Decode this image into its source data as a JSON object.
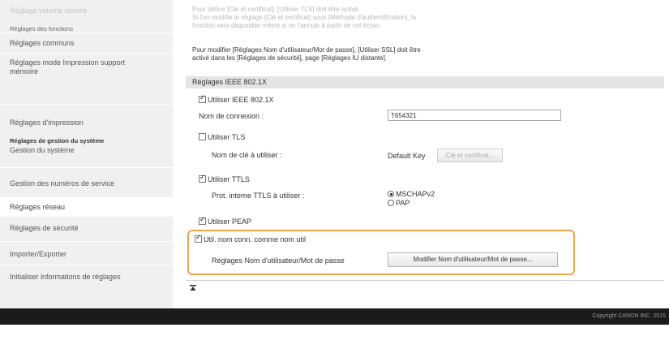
{
  "sidebar": {
    "cut_item": "Réglage volume sonore",
    "section_functions": "Réglages des fonctions",
    "items_functions": [
      "Réglages communs",
      "Réglages mode Impression support mémoire",
      "Réglages d'impression"
    ],
    "section_system": "Réglages de gestion du système",
    "items_system": [
      "Gestion du système",
      "Gestion des numéros de service",
      "Réglages réseau",
      "Réglages de sécurité",
      "Importer/Exporter",
      "Initialiser informations de réglages"
    ]
  },
  "notes": {
    "faded": [
      "Pour définir [Clé et certificat], [Utiliser TLS] doit être activé.",
      "Si l'on modifie le réglage [Clé et certificat] sous [Méthode d'authentification], la",
      "fonction sera disponible même si on l'annule à partir de cet écran."
    ],
    "dark": [
      "Pour modifier [Réglages Nom d'utilisateur/Mot de passe], [Utiliser SSL] doit être",
      "activé dans les [Réglages de sécurité], page [Réglages IU distante]."
    ]
  },
  "section": {
    "title": "Réglages IEEE 802.1X"
  },
  "form": {
    "use_ieee": {
      "label": "Utiliser IEEE 802.1X",
      "checked": true
    },
    "login_name": {
      "label": "Nom de connexion :",
      "value": "T654321"
    },
    "use_tls": {
      "label": "Utiliser TLS",
      "checked": false
    },
    "key_label": "Nom de clé à utiliser :",
    "key_value": "Default Key",
    "key_button": "Clé et certificat...",
    "use_ttls": {
      "label": "Utiliser TTLS",
      "checked": true
    },
    "ttls_protocol_label": "Prot. interne TTLS à utiliser :",
    "ttls_options": [
      {
        "label": "MSCHAPv2",
        "selected": true
      },
      {
        "label": "PAP",
        "selected": false
      }
    ],
    "use_peap": {
      "label": "Utiliser PEAP",
      "checked": true
    },
    "use_login_as_user": {
      "label": "Util. nom conn. comme nom util",
      "checked": true
    },
    "credentials_label": "Réglages Nom d'utilisateur/Mot de passe",
    "credentials_button": "Modifier Nom d'utilisateur/Mot de passe..."
  },
  "footer": {
    "copyright": "Copyright CANON INC. 2015"
  },
  "icons": {
    "to_top": "page-top-icon"
  }
}
